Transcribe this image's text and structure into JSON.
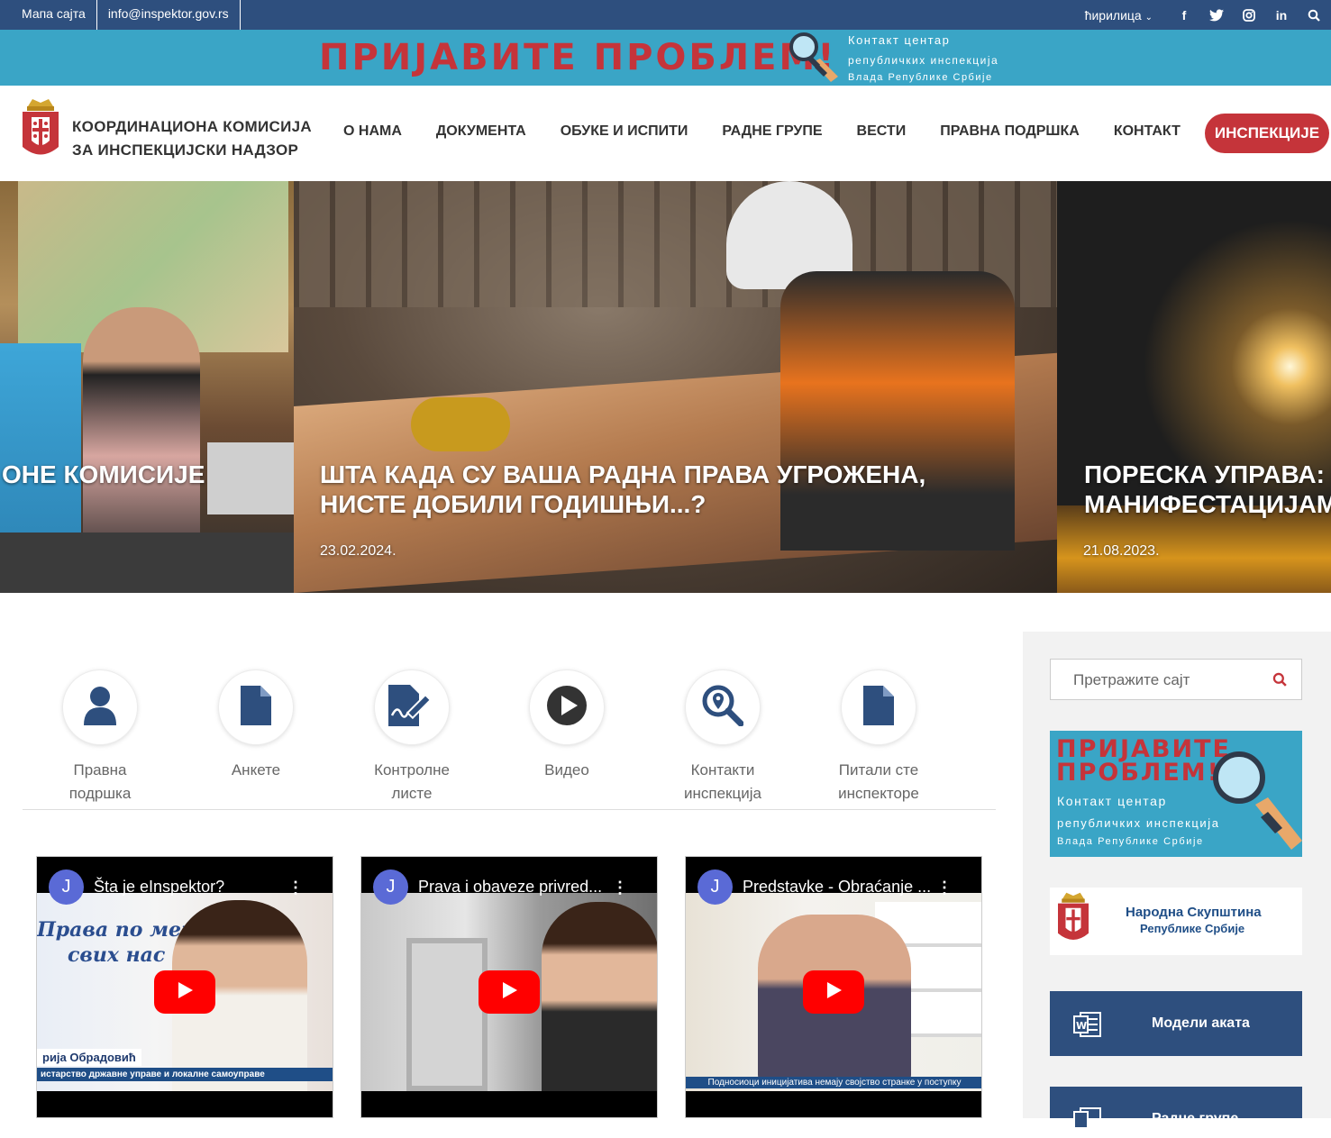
{
  "topbar": {
    "sitemap": "Мапа сајта",
    "email": "info@inspektor.gov.rs",
    "language": "ћирилица",
    "social_icons": [
      "facebook-icon",
      "twitter-icon",
      "instagram-icon",
      "linkedin-icon",
      "search-icon"
    ]
  },
  "banner": {
    "headline": "ПРИЈАВИТЕ ПРОБЛЕМ!",
    "line1": "Контакт центар",
    "line2": "републичких инспекција",
    "line3": "Влада Републике Србије"
  },
  "header": {
    "org_line1": "КООРДИНАЦИОНА КОМИСИЈА",
    "org_line2": "ЗА ИНСПЕКЦИЈСКИ НАДЗОР",
    "nav": [
      "О НАМА",
      "ДОКУМЕНТА",
      "ОБУКЕ И ИСПИТИ",
      "РАДНЕ ГРУПЕ",
      "ВЕСТИ",
      "ПРАВНА ПОДРШКА",
      "КОНТАКТ"
    ],
    "cta": "ИНСПЕКЦИЈЕ"
  },
  "slider": {
    "slides": [
      {
        "title1": "ОНЕ КОМИСИЈЕ",
        "title2": "",
        "date": ""
      },
      {
        "title1": "ШТА КАДА СУ ВАША РАДНА ПРАВА УГРОЖЕНА,",
        "title2": "НИСТЕ ДОБИЛИ ГОДИШЊИ...?",
        "date": "23.02.2024."
      },
      {
        "title1": "ПОРЕСКА УПРАВА: И",
        "title2": "МАНИФЕСТАЦИЈАМА",
        "date": "21.08.2023."
      }
    ]
  },
  "quick_links": [
    {
      "line1": "Правна",
      "line2": "подршка",
      "icon": "user-icon"
    },
    {
      "line1": "Анкете",
      "line2": "",
      "icon": "document-icon"
    },
    {
      "line1": "Контролне",
      "line2": "листе",
      "icon": "signature-icon"
    },
    {
      "line1": "Видео",
      "line2": "",
      "icon": "play-icon"
    },
    {
      "line1": "Контакти",
      "line2": "инспекција",
      "icon": "location-search-icon"
    },
    {
      "line1": "Питали сте",
      "line2": "инспекторе",
      "icon": "document-icon"
    }
  ],
  "videos": [
    {
      "avatar": "J",
      "title": "Šta je eInspektor?",
      "overlay1": "Права по мери",
      "overlay2": "свих нас",
      "caption1": "рија Обрадовић",
      "caption2": "истарство државне управе и локалне самоуправе"
    },
    {
      "avatar": "J",
      "title": "Prava i obaveze privred...",
      "overlay1": "",
      "overlay2": "",
      "caption1": "",
      "caption2": ""
    },
    {
      "avatar": "J",
      "title": "Predstavke - Obraćanje ...",
      "overlay1": "",
      "overlay2": "",
      "caption1": "Подносиоци иницијатива немају својство странке у поступку",
      "caption2": ""
    }
  ],
  "sidebar": {
    "search_placeholder": "Претражите сајт",
    "banner_headline1": "ПРИЈАВИТЕ",
    "banner_headline2": "ПРОБЛЕМ!",
    "banner_line1": "Контакт центар",
    "banner_line2": "републичких инспекција",
    "banner_line3": "Влада Републике Србије",
    "parliament_line1": "Народна Скупштина",
    "parliament_line2": "Републике Србије",
    "button1": "Модели аката",
    "button2": "Радне групе"
  },
  "colors": {
    "navy": "#2e4f7e",
    "teal": "#3aa5c6",
    "red": "#c5343a"
  }
}
